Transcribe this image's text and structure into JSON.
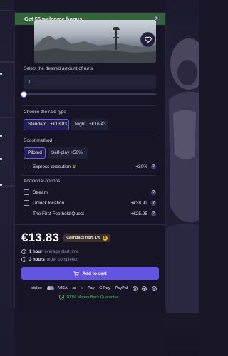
{
  "banner": {
    "text": "Get $5 welcome bonus!",
    "help_icon": "question-icon"
  },
  "hero": {
    "favorite_icon": "heart-icon"
  },
  "runs": {
    "label": "Select the desired amount of runs",
    "value": "1",
    "slider_fraction": 0
  },
  "raid_type": {
    "label": "Choose the raid type",
    "options": [
      {
        "name": "Standard",
        "price": "+€13.83",
        "selected": true
      },
      {
        "name": "Night",
        "price": "+€16.43",
        "selected": false
      }
    ]
  },
  "boost": {
    "label": "Boost method",
    "options": [
      {
        "label": "Piloted",
        "selected": true
      },
      {
        "label": "Self-play +50%",
        "selected": false
      }
    ],
    "express": {
      "label": "Express execution",
      "icon": "crown-icon",
      "price": "+30%"
    }
  },
  "additional": {
    "label": "Additional options",
    "items": [
      {
        "label": "Stream",
        "price": ""
      },
      {
        "label": "Unlock location",
        "price": "+€38.92"
      },
      {
        "label": "The First Foothold Quest",
        "price": "+€25.95"
      }
    ]
  },
  "summary": {
    "price": "€13.83",
    "cashback": "Cashback from 1%",
    "cashback_coin": "₿",
    "start_value": "1 hour",
    "start_text": "average start time",
    "completion_value": "3 hours",
    "completion_text": "order completion",
    "cart_label": "Add to cart"
  },
  "payments": [
    "stripe",
    "VISA",
    "Pay",
    "G Pay",
    "PayPal"
  ],
  "guarantee": "100% Money-Back Guarantee",
  "colors": {
    "accent": "#6354e1",
    "banner": "#33623b",
    "panel": "#171525",
    "guarantee": "#4fbf63"
  }
}
